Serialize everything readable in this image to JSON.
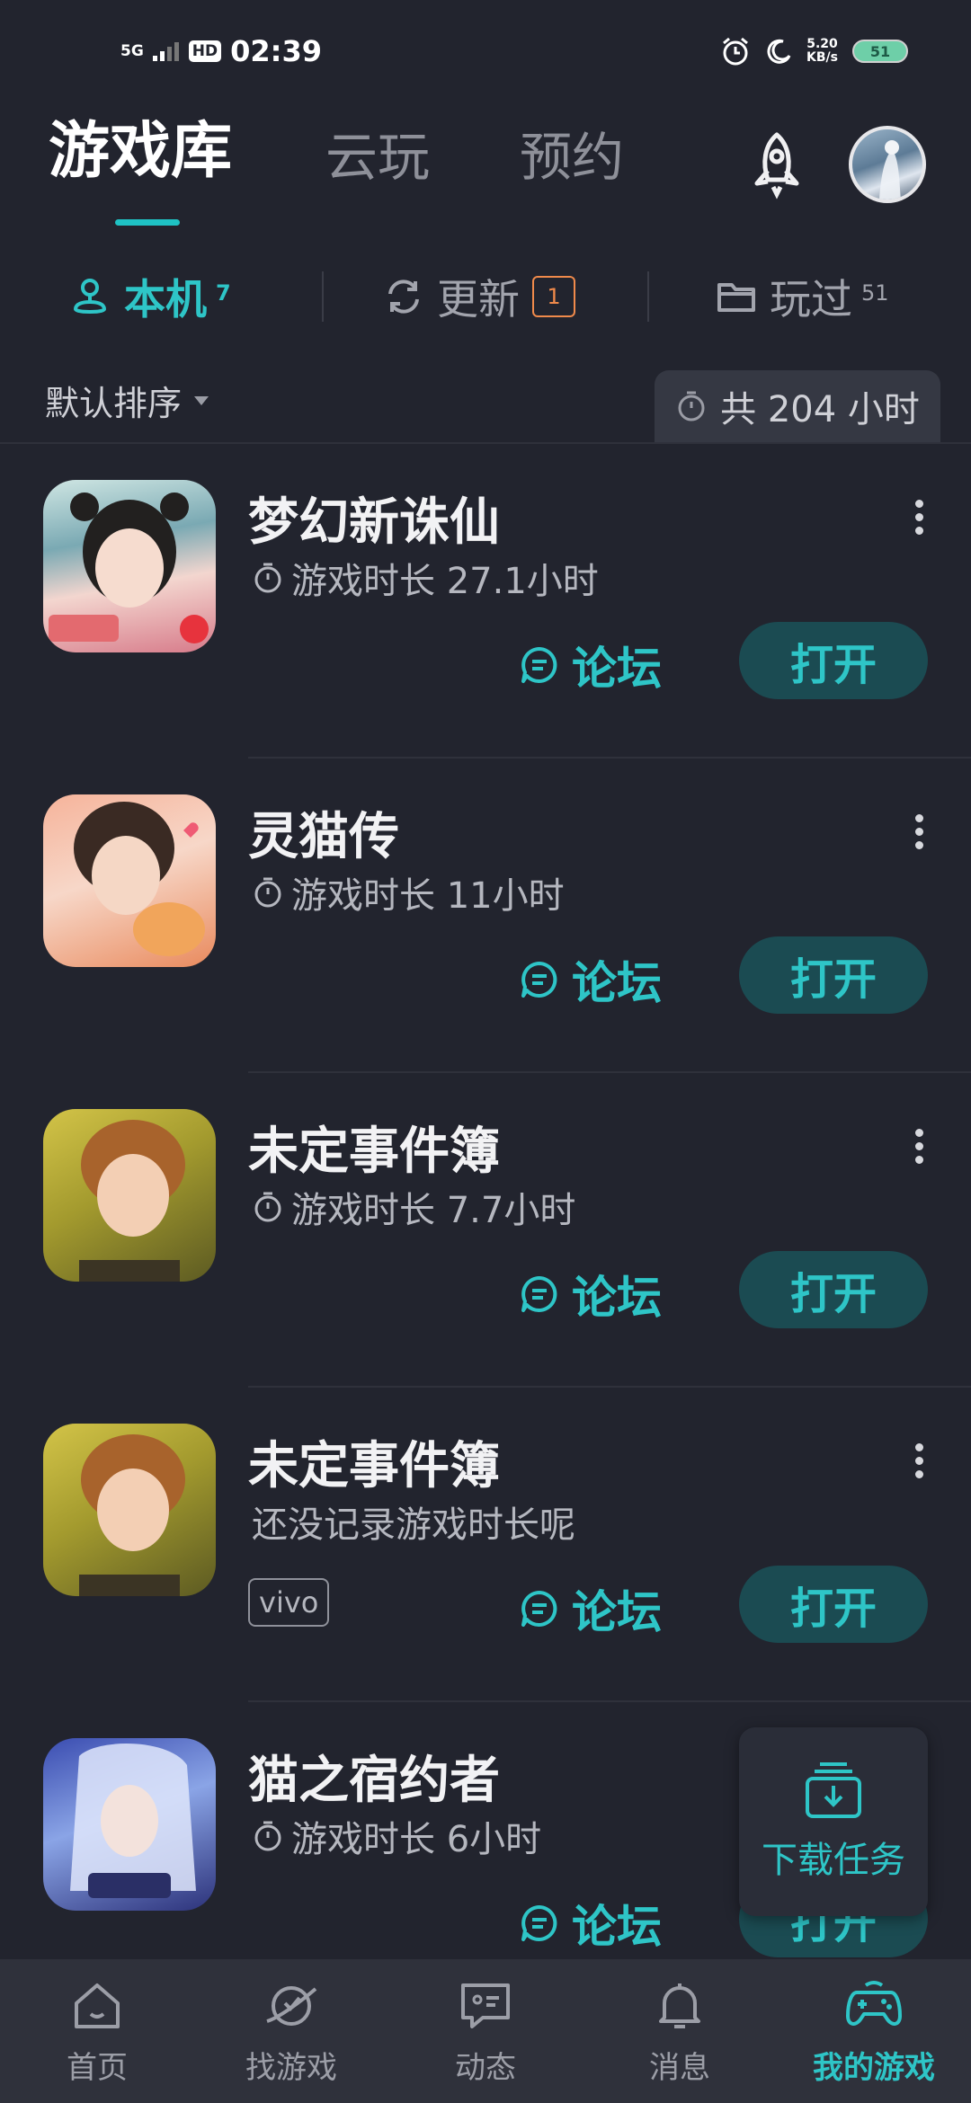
{
  "status_bar": {
    "network": "5G",
    "hd": "HD",
    "time": "02:39",
    "speed_value": "5.20",
    "speed_unit": "KB/s",
    "battery": "51"
  },
  "header": {
    "tabs": [
      {
        "label": "游戏库",
        "active": true
      },
      {
        "label": "云玩",
        "active": false
      },
      {
        "label": "预约",
        "active": false
      }
    ]
  },
  "subtabs": {
    "local": {
      "label": "本机",
      "count": "7"
    },
    "update": {
      "label": "更新",
      "badge": "1"
    },
    "played": {
      "label": "玩过",
      "count": "51"
    }
  },
  "sort": {
    "label": "默认排序"
  },
  "total_time": {
    "label": "共 204 小时"
  },
  "games": [
    {
      "title": "梦幻新诛仙",
      "subtitle": "游戏时长 27.1小时",
      "has_timer": true,
      "forum": "论坛",
      "open": "打开",
      "tag": ""
    },
    {
      "title": "灵猫传",
      "subtitle": "游戏时长 11小时",
      "has_timer": true,
      "forum": "论坛",
      "open": "打开",
      "tag": ""
    },
    {
      "title": "未定事件簿",
      "subtitle": "游戏时长 7.7小时",
      "has_timer": true,
      "forum": "论坛",
      "open": "打开",
      "tag": ""
    },
    {
      "title": "未定事件簿",
      "subtitle": "还没记录游戏时长呢",
      "has_timer": false,
      "forum": "论坛",
      "open": "打开",
      "tag": "vivo"
    },
    {
      "title": "猫之宿约者",
      "subtitle": "游戏时长 6小时",
      "has_timer": true,
      "forum": "论坛",
      "open": "打开",
      "tag": ""
    }
  ],
  "download_float": {
    "label": "下载任务"
  },
  "bottom_nav": [
    {
      "label": "首页",
      "icon": "home-icon",
      "active": false
    },
    {
      "label": "找游戏",
      "icon": "planet-icon",
      "active": false
    },
    {
      "label": "动态",
      "icon": "chat-icon",
      "active": false
    },
    {
      "label": "消息",
      "icon": "bell-icon",
      "active": false
    },
    {
      "label": "我的游戏",
      "icon": "gamepad-icon",
      "active": true
    }
  ],
  "colors": {
    "background": "#22242e",
    "accent": "#2ec5c7",
    "button_bg": "#1b4b52",
    "badge": "#f08a4b"
  }
}
